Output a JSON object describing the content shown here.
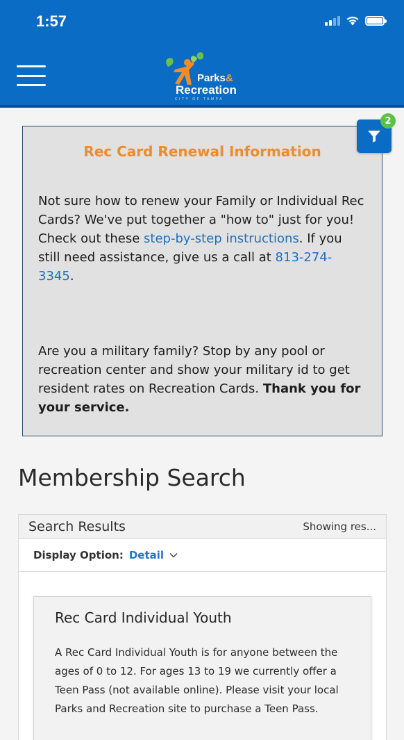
{
  "status_bar": {
    "time": "1:57"
  },
  "header": {
    "logo_line1": "Parks",
    "logo_amp": "&",
    "logo_line2": "Recreation",
    "logo_line3": "CITY OF TAMPA"
  },
  "info": {
    "title": "Rec Card Renewal Information",
    "p1_before": "Not sure how to renew your Family or Individual Rec Cards? We've put together a \"how to\" just for you! Check out these ",
    "p1_link": "step-by-step instructions",
    "p1_middle": ". If you still need assistance, give us a call at ",
    "p1_phone": "813-274-3345",
    "p1_after": ".",
    "p2_text": "Are you a military family? Stop by any pool or recreation center and show your military id to get resident rates on Recreation Cards. ",
    "p2_bold": "Thank you for your service."
  },
  "filter": {
    "badge_count": "2"
  },
  "page_title": "Membership Search",
  "results": {
    "title": "Search Results",
    "showing": "Showing res...",
    "display_label": "Display Option:",
    "display_value": "Detail",
    "card": {
      "title": "Rec Card Individual Youth",
      "description": "A Rec Card Individual Youth is for anyone between the ages of 0 to 12. For ages 13 to 19 we currently offer a Teen Pass (not available online). Please visit your local Parks and Recreation site to purchase a Teen Pass."
    }
  },
  "colors": {
    "header_blue": "#0b6cc6",
    "accent_orange": "#ef8b2c",
    "link_blue": "#1f6fbf",
    "badge_green": "#5cc247"
  }
}
